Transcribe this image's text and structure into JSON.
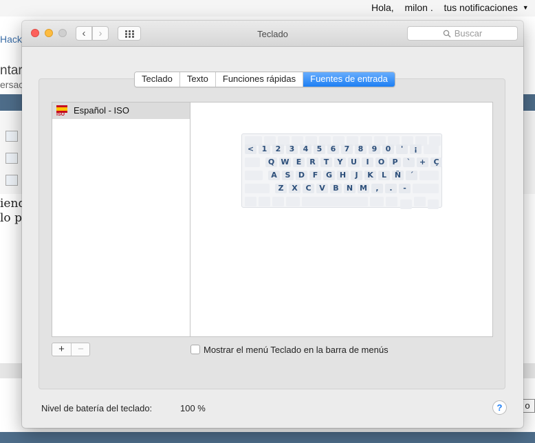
{
  "background": {
    "greeting_prefix": "Hola,",
    "greeting_name": "milon .",
    "notifications": "tus notificaciones",
    "partial_hacki": "Hacki",
    "partial_tar": "ntar",
    "partial_ersac": "ersac",
    "partial_iend": "iend",
    "partial_lop": "lo p",
    "partial_button": "o"
  },
  "window": {
    "title": "Teclado",
    "search_placeholder": "Buscar",
    "tabs": [
      {
        "label": "Teclado",
        "active": false
      },
      {
        "label": "Texto",
        "active": false
      },
      {
        "label": "Funciones rápidas",
        "active": false
      },
      {
        "label": "Fuentes de entrada",
        "active": true
      }
    ],
    "input_sources": [
      {
        "label": "Español - ISO",
        "flag_icon": "spain-flag-icon",
        "flag_text": "ISO",
        "selected": true
      }
    ],
    "keyboard_preview": {
      "row1": [
        "<",
        "1",
        "2",
        "3",
        "4",
        "5",
        "6",
        "7",
        "8",
        "9",
        "0",
        "'",
        "¡"
      ],
      "row2": [
        "Q",
        "W",
        "E",
        "R",
        "T",
        "Y",
        "U",
        "I",
        "O",
        "P",
        "`",
        "+",
        "Ç"
      ],
      "row3": [
        "A",
        "S",
        "D",
        "F",
        "G",
        "H",
        "J",
        "K",
        "L",
        "Ñ",
        "´"
      ],
      "row4": [
        "Z",
        "X",
        "C",
        "V",
        "B",
        "N",
        "M",
        ",",
        ".",
        "-"
      ]
    },
    "add_label": "+",
    "remove_label": "−",
    "show_menu_label": "Mostrar el menú Teclado en la barra de menús",
    "show_menu_checked": false,
    "battery_label": "Nivel de batería del teclado:",
    "battery_value": "100 %",
    "help_label": "?"
  },
  "colors": {
    "accent": "#1d7ff3",
    "close": "#fc605b",
    "minimize": "#fdbc40",
    "zoom_disabled": "#cfcfcf",
    "key_text": "#2d4f7a"
  }
}
